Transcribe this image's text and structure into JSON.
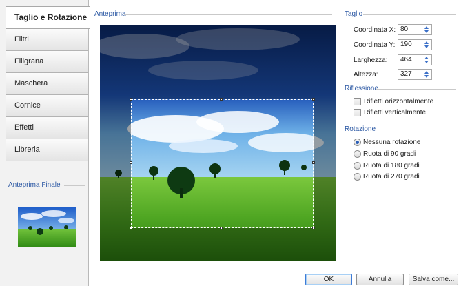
{
  "tabs": [
    {
      "label": "Taglio e Rotazione",
      "active": true
    },
    {
      "label": "Filtri"
    },
    {
      "label": "Filigrana"
    },
    {
      "label": "Maschera"
    },
    {
      "label": "Cornice"
    },
    {
      "label": "Effetti"
    },
    {
      "label": "Libreria"
    }
  ],
  "final_preview": {
    "label": "Anteprima Finale"
  },
  "preview": {
    "label": "Anteprima"
  },
  "crop": {
    "label": "Taglio",
    "fields": [
      {
        "label": "Coordinata X:",
        "value": "80"
      },
      {
        "label": "Coordinata Y:",
        "value": "190"
      },
      {
        "label": "Larghezza:",
        "value": "464"
      },
      {
        "label": "Altezza:",
        "value": "327"
      }
    ]
  },
  "reflection": {
    "label": "Riflessione",
    "options": [
      {
        "label": "Rifletti orizzontalmente",
        "checked": false
      },
      {
        "label": "Rifletti verticalmente",
        "checked": false
      }
    ]
  },
  "rotation": {
    "label": "Rotazione",
    "options": [
      {
        "label": "Nessuna rotazione",
        "checked": true
      },
      {
        "label": "Ruota di 90 gradi",
        "checked": false
      },
      {
        "label": "Ruota di 180 gradi",
        "checked": false
      },
      {
        "label": "Ruota di 270 gradi",
        "checked": false
      }
    ]
  },
  "buttons": {
    "ok": "OK",
    "cancel": "Annulla",
    "save_as": "Salva come..."
  },
  "colors": {
    "accent": "#2a57a3",
    "radio_selected": "#2b5fb8"
  }
}
